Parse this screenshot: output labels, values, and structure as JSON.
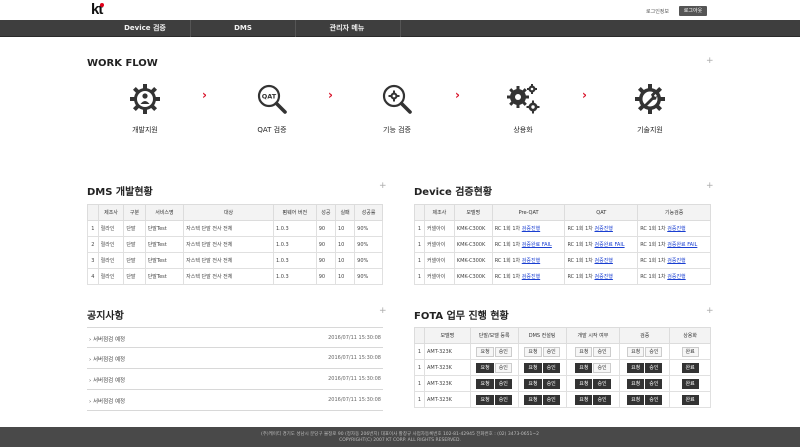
{
  "header": {
    "logo_text": "kt",
    "user_info": "로그인정보",
    "logout": "로그아웃"
  },
  "nav": {
    "items": [
      {
        "label": "Device 검증"
      },
      {
        "label": "DMS"
      },
      {
        "label": "관리자 메뉴"
      }
    ]
  },
  "workflow": {
    "title": "WORK FLOW",
    "plus": "+",
    "steps": [
      {
        "label": "개발지원",
        "icon": "gear-person-icon"
      },
      {
        "label": "QAT 검증",
        "icon": "magnifier-qat-icon",
        "icon_text": "QAT"
      },
      {
        "label": "기능 검증",
        "icon": "magnifier-gear-icon"
      },
      {
        "label": "상용화",
        "icon": "gears-icon"
      },
      {
        "label": "기술지원",
        "icon": "gear-wrench-icon"
      }
    ],
    "arrow": "›",
    "arrow_color": "#d9142b"
  },
  "dms": {
    "title": "DMS 개발현황",
    "plus": "+",
    "headers": [
      "",
      "제조사",
      "구분",
      "서비스명",
      "대상",
      "펌웨어 버전",
      "성공",
      "실패",
      "성공률"
    ],
    "rows": [
      [
        "1",
        "릴라인",
        "단말",
        "단말Test",
        "자스텍 단말 전사 전체",
        "1.0.3",
        "90",
        "10",
        "90%"
      ],
      [
        "2",
        "릴라인",
        "단말",
        "단말Test",
        "자스텍 단말 전사 전체",
        "1.0.3",
        "90",
        "10",
        "90%"
      ],
      [
        "3",
        "릴라인",
        "단말",
        "단말Test",
        "자스텍 단말 전사 전체",
        "1.0.3",
        "90",
        "10",
        "90%"
      ],
      [
        "4",
        "릴라인",
        "단말",
        "단말Test",
        "자스텍 단말 전사 전체",
        "1.0.3",
        "90",
        "10",
        "90%"
      ]
    ]
  },
  "device": {
    "title": "Device 검증현황",
    "plus": "+",
    "headers": [
      "",
      "제조사",
      "모델명",
      "Pre-QAT",
      "QAT",
      "기능검증"
    ],
    "rows": [
      {
        "no": "1",
        "maker": "커넬아이",
        "model": "KMK-C300K",
        "pre_prefix": "RC 1회 1차",
        "pre_link": "검증진행",
        "qat_prefix": "RC 1회 1차",
        "qat_link": "검증진행",
        "func_prefix": "RC 1회 1차",
        "func_link": "검증진행"
      },
      {
        "no": "1",
        "maker": "커넬아이",
        "model": "KMK-C300K",
        "pre_prefix": "RC 1회 1차",
        "pre_link": "검증완료 FAIL",
        "qat_prefix": "RC 1회 1차",
        "qat_link": "검증완료 FAIL",
        "func_prefix": "RC 1회 1차",
        "func_link": "검증완료 FAIL"
      },
      {
        "no": "1",
        "maker": "커넬아이",
        "model": "KMK-C300K",
        "pre_prefix": "RC 1회 1차",
        "pre_link": "검증진행",
        "qat_prefix": "RC 1회 1차",
        "qat_link": "검증진행",
        "func_prefix": "RC 1회 1차",
        "func_link": "검증진행"
      },
      {
        "no": "1",
        "maker": "커넬아이",
        "model": "KMK-C300K",
        "pre_prefix": "RC 1회 1차",
        "pre_link": "검증진행",
        "qat_prefix": "RC 1회 1차",
        "qat_link": "검증진행",
        "func_prefix": "RC 1회 1차",
        "func_link": "검증진행"
      }
    ]
  },
  "notices": {
    "title": "공지사항",
    "plus": "+",
    "items": [
      {
        "title": "서버점검 예정",
        "date": "2016/07/11 15:30:08"
      },
      {
        "title": "서버점검 예정",
        "date": "2016/07/11 15:30:08"
      },
      {
        "title": "서버점검 예정",
        "date": "2016/07/11 15:30:08"
      },
      {
        "title": "서버점검 예정",
        "date": "2016/07/11 15:30:08"
      }
    ]
  },
  "fota": {
    "title": "FOTA 업무 진행 현황",
    "plus": "+",
    "headers": [
      "",
      "모델명",
      "단말/모델 등록",
      "DMS 컨설팅",
      "개발 시작 여부",
      "검증",
      "상용화"
    ],
    "btn_request": "요청",
    "btn_approve": "승인",
    "btn_done": "완료",
    "rows": [
      {
        "no": "1",
        "model": "AMT-323K"
      },
      {
        "no": "1",
        "model": "AMT-323K"
      },
      {
        "no": "1",
        "model": "AMT-323K"
      },
      {
        "no": "1",
        "model": "AMT-323K"
      }
    ]
  },
  "footer": {
    "line1": "(주)케이티 경기도 성남시 분당구 불정로 90 (정자동 206번지)   대표이사 황창규 사업자등록번호 102-81-42945   전화번호 : (02) 3473-0651~2",
    "line2": "COPYRIGHT(C) 2007 KT CORP. ALL RIGHTS RESERVED."
  }
}
